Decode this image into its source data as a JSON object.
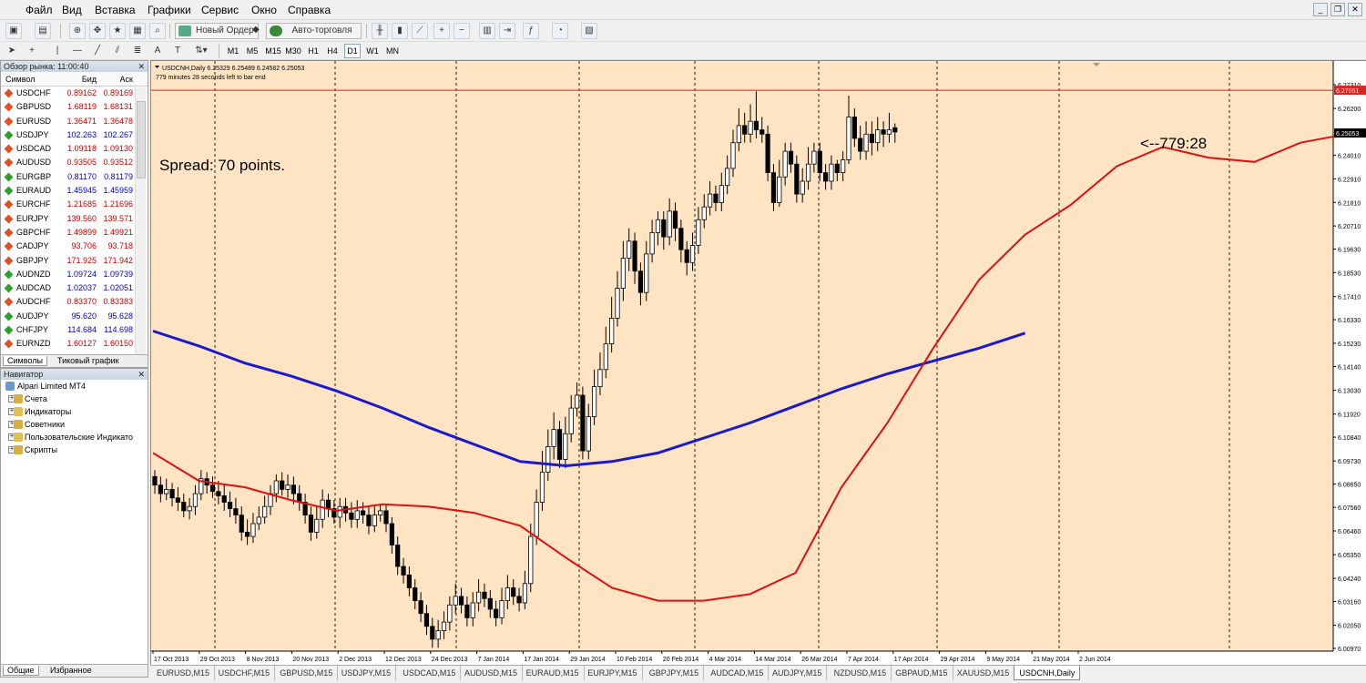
{
  "menu": [
    "Файл",
    "Вид",
    "Вставка",
    "Графики",
    "Сервис",
    "Окно",
    "Справка"
  ],
  "toolbar": {
    "new_order": "Новый Ордер",
    "autotrade": "Авто-торговля"
  },
  "timeframes": [
    "M1",
    "M5",
    "M15",
    "M30",
    "H1",
    "H4",
    "D1",
    "W1",
    "MN"
  ],
  "active_timeframe": "D1",
  "market_watch": {
    "title": "Обзор рынка: 11:00:40",
    "headers": {
      "symbol": "Символ",
      "bid": "Бид",
      "ask": "Аск"
    },
    "rows": [
      {
        "symbol": "USDCHF",
        "bid": "0.89162",
        "ask": "0.89169",
        "dir": "dn"
      },
      {
        "symbol": "GBPUSD",
        "bid": "1.68119",
        "ask": "1.68131",
        "dir": "dn"
      },
      {
        "symbol": "EURUSD",
        "bid": "1.36471",
        "ask": "1.36478",
        "dir": "dn"
      },
      {
        "symbol": "USDJPY",
        "bid": "102.263",
        "ask": "102.267",
        "dir": "up"
      },
      {
        "symbol": "USDCAD",
        "bid": "1.09118",
        "ask": "1.09130",
        "dir": "dn"
      },
      {
        "symbol": "AUDUSD",
        "bid": "0.93505",
        "ask": "0.93512",
        "dir": "dn"
      },
      {
        "symbol": "EURGBP",
        "bid": "0.81170",
        "ask": "0.81179",
        "dir": "up"
      },
      {
        "symbol": "EURAUD",
        "bid": "1.45945",
        "ask": "1.45959",
        "dir": "up"
      },
      {
        "symbol": "EURCHF",
        "bid": "1.21685",
        "ask": "1.21696",
        "dir": "dn"
      },
      {
        "symbol": "EURJPY",
        "bid": "139.560",
        "ask": "139.571",
        "dir": "dn"
      },
      {
        "symbol": "GBPCHF",
        "bid": "1.49899",
        "ask": "1.49921",
        "dir": "dn"
      },
      {
        "symbol": "CADJPY",
        "bid": "93.706",
        "ask": "93.718",
        "dir": "dn"
      },
      {
        "symbol": "GBPJPY",
        "bid": "171.925",
        "ask": "171.942",
        "dir": "dn"
      },
      {
        "symbol": "AUDNZD",
        "bid": "1.09724",
        "ask": "1.09739",
        "dir": "up"
      },
      {
        "symbol": "AUDCAD",
        "bid": "1.02037",
        "ask": "1.02051",
        "dir": "up"
      },
      {
        "symbol": "AUDCHF",
        "bid": "0.83370",
        "ask": "0.83383",
        "dir": "dn"
      },
      {
        "symbol": "AUDJPY",
        "bid": "95.620",
        "ask": "95.628",
        "dir": "up"
      },
      {
        "symbol": "CHFJPY",
        "bid": "114.684",
        "ask": "114.698",
        "dir": "up"
      },
      {
        "symbol": "EURNZD",
        "bid": "1.60127",
        "ask": "1.60150",
        "dir": "dn"
      }
    ],
    "tabs": [
      "Символы",
      "Тиковый график"
    ]
  },
  "navigator": {
    "title": "Навигатор",
    "root": "Alpari Limited MT4",
    "items": [
      "Счета",
      "Индикаторы",
      "Советники",
      "Пользовательские Индикато",
      "Скрипты"
    ],
    "tabs": [
      "Общие",
      "Избранное"
    ]
  },
  "chart_tabs": [
    "EURUSD,M15",
    "USDCHF,M15",
    "GBPUSD,M15",
    "USDJPY,M15",
    "USDCAD,M15",
    "AUDUSD,M15",
    "EURAUD,M15",
    "EURJPY,M15",
    "GBPJPY,M15",
    "AUDCAD,M15",
    "AUDJPY,M15",
    "NZDUSD,M15",
    "GBPAUD,M15",
    "XAUUSD,M15",
    "USDCNH,Daily"
  ],
  "active_chart_tab": "USDCNH,Daily",
  "chart_data": {
    "type": "candlestick",
    "symbol_line": "USDCNH,Daily  6.25329 6.25489 6.24582 6.25053",
    "timer_line": "779 minutes 28 seconds left to bar end",
    "spread_text": "Spread: 70 points.",
    "countdown_text": "<--779:28",
    "ylim": [
      6.0097,
      6.2731
    ],
    "y_ticks": [
      "6.27310",
      "6.26200",
      "6.25053",
      "6.24010",
      "6.22910",
      "6.21810",
      "6.20710",
      "6.19630",
      "6.18530",
      "6.17410",
      "6.16330",
      "6.15230",
      "6.14140",
      "6.13030",
      "6.11920",
      "6.10840",
      "6.09730",
      "6.08650",
      "6.07560",
      "6.06460",
      "6.05350",
      "6.04240",
      "6.03160",
      "6.02050",
      "6.00970"
    ],
    "y_tick_values": [
      6.2731,
      6.262,
      6.25053,
      6.2401,
      6.2291,
      6.2181,
      6.2071,
      6.1963,
      6.1853,
      6.1741,
      6.1633,
      6.1523,
      6.1414,
      6.1303,
      6.1192,
      6.1084,
      6.0973,
      6.0865,
      6.0756,
      6.0646,
      6.0535,
      6.0424,
      6.0316,
      6.0205,
      6.0097
    ],
    "price_line": 6.27051,
    "price_line_label": "6.27051",
    "current_price": 6.25053,
    "current_price_label": "6.25053",
    "x_labels": [
      "17 Oct 2013",
      "29 Oct 2013",
      "8 Nov 2013",
      "20 Nov 2013",
      "2 Dec 2013",
      "12 Dec 2013",
      "24 Dec 2013",
      "7 Jan 2014",
      "17 Jan 2014",
      "29 Jan 2014",
      "10 Feb 2014",
      "20 Feb 2014",
      "4 Mar 2014",
      "14 Mar 2014",
      "26 Mar 2014",
      "7 Apr 2014",
      "17 Apr 2014",
      "29 Apr 2014",
      "9 May 2014",
      "21 May 2014",
      "2 Jun 2014"
    ],
    "x_label_index": [
      0,
      8,
      16,
      24,
      32,
      40,
      48,
      56,
      64,
      72,
      80,
      88,
      96,
      104,
      112,
      120,
      128,
      136,
      144,
      152,
      160
    ],
    "bars_total": 164,
    "ma_slow_color": "#1a1acc",
    "ma_fast_color": "#dd1111",
    "ma_slow": [
      [
        0,
        6.158
      ],
      [
        20,
        6.151
      ],
      [
        40,
        6.143
      ],
      [
        60,
        6.137
      ],
      [
        80,
        6.13
      ],
      [
        100,
        6.122
      ],
      [
        120,
        6.113
      ],
      [
        140,
        6.105
      ],
      [
        160,
        6.097
      ],
      [
        180,
        6.095
      ],
      [
        200,
        6.097
      ],
      [
        220,
        6.101
      ],
      [
        240,
        6.108
      ],
      [
        260,
        6.115
      ],
      [
        280,
        6.123
      ],
      [
        300,
        6.131
      ],
      [
        320,
        6.138
      ],
      [
        340,
        6.144
      ],
      [
        360,
        6.15
      ],
      [
        380,
        6.157
      ]
    ],
    "ma_fast": [
      [
        0,
        6.101
      ],
      [
        20,
        6.088
      ],
      [
        40,
        6.085
      ],
      [
        60,
        6.079
      ],
      [
        80,
        6.074
      ],
      [
        100,
        6.077
      ],
      [
        120,
        6.076
      ],
      [
        140,
        6.073
      ],
      [
        160,
        6.067
      ],
      [
        180,
        6.052
      ],
      [
        200,
        6.038
      ],
      [
        220,
        6.032
      ],
      [
        240,
        6.032
      ],
      [
        260,
        6.035
      ],
      [
        280,
        6.045
      ],
      [
        300,
        6.085
      ],
      [
        320,
        6.115
      ],
      [
        340,
        6.15
      ],
      [
        360,
        6.182
      ],
      [
        380,
        6.203
      ],
      [
        400,
        6.217
      ],
      [
        420,
        6.235
      ],
      [
        440,
        6.244
      ],
      [
        460,
        6.239
      ],
      [
        480,
        6.237
      ],
      [
        500,
        6.246
      ],
      [
        520,
        6.25
      ]
    ],
    "candles": [
      [
        6.09,
        6.086,
        6.093,
        6.082
      ],
      [
        6.086,
        6.082,
        6.09,
        6.078
      ],
      [
        6.082,
        6.084,
        6.089,
        6.079
      ],
      [
        6.084,
        6.08,
        6.087,
        6.076
      ],
      [
        6.08,
        6.078,
        6.085,
        6.074
      ],
      [
        6.078,
        6.074,
        6.082,
        6.071
      ],
      [
        6.074,
        6.076,
        6.08,
        6.07
      ],
      [
        6.076,
        6.082,
        6.086,
        6.072
      ],
      [
        6.082,
        6.089,
        6.093,
        6.079
      ],
      [
        6.089,
        6.086,
        6.092,
        6.082
      ],
      [
        6.086,
        6.083,
        6.09,
        6.08
      ],
      [
        6.083,
        6.081,
        6.088,
        6.077
      ],
      [
        6.081,
        6.078,
        6.086,
        6.074
      ],
      [
        6.078,
        6.075,
        6.083,
        6.071
      ],
      [
        6.075,
        6.072,
        6.08,
        6.068
      ],
      [
        6.072,
        6.064,
        6.076,
        6.06
      ],
      [
        6.064,
        6.062,
        6.07,
        6.058
      ],
      [
        6.062,
        6.068,
        6.073,
        6.059
      ],
      [
        6.068,
        6.071,
        6.076,
        6.065
      ],
      [
        6.071,
        6.076,
        6.081,
        6.068
      ],
      [
        6.076,
        6.082,
        6.086,
        6.072
      ],
      [
        6.082,
        6.088,
        6.091,
        6.078
      ],
      [
        6.088,
        6.084,
        6.092,
        6.081
      ],
      [
        6.084,
        6.086,
        6.091,
        6.08
      ],
      [
        6.086,
        6.082,
        6.09,
        6.077
      ],
      [
        6.082,
        6.078,
        6.086,
        6.074
      ],
      [
        6.078,
        6.072,
        6.082,
        6.068
      ],
      [
        6.072,
        6.064,
        6.076,
        6.06
      ],
      [
        6.064,
        6.07,
        6.076,
        6.061
      ],
      [
        6.07,
        6.079,
        6.084,
        6.066
      ],
      [
        6.079,
        6.075,
        6.082,
        6.071
      ],
      [
        6.075,
        6.071,
        6.079,
        6.068
      ],
      [
        6.071,
        6.076,
        6.08,
        6.066
      ],
      [
        6.076,
        6.073,
        6.08,
        6.069
      ],
      [
        6.073,
        6.07,
        6.078,
        6.066
      ],
      [
        6.07,
        6.074,
        6.079,
        6.066
      ],
      [
        6.074,
        6.072,
        6.078,
        6.068
      ],
      [
        6.072,
        6.067,
        6.076,
        6.063
      ],
      [
        6.067,
        6.072,
        6.076,
        6.064
      ],
      [
        6.072,
        6.074,
        6.077,
        6.069
      ],
      [
        6.074,
        6.068,
        6.077,
        6.064
      ],
      [
        6.068,
        6.058,
        6.071,
        6.054
      ],
      [
        6.058,
        6.048,
        6.062,
        6.044
      ],
      [
        6.048,
        6.044,
        6.052,
        6.04
      ],
      [
        6.044,
        6.038,
        6.048,
        6.034
      ],
      [
        6.038,
        6.032,
        6.042,
        6.028
      ],
      [
        6.032,
        6.026,
        6.036,
        6.022
      ],
      [
        6.026,
        6.02,
        6.03,
        6.016
      ],
      [
        6.02,
        6.014,
        6.024,
        6.01
      ],
      [
        6.014,
        6.018,
        6.023,
        6.01
      ],
      [
        6.018,
        6.022,
        6.027,
        6.014
      ],
      [
        6.022,
        6.03,
        6.034,
        6.018
      ],
      [
        6.03,
        6.034,
        6.04,
        6.026
      ],
      [
        6.034,
        6.03,
        6.038,
        6.026
      ],
      [
        6.03,
        6.024,
        6.034,
        6.02
      ],
      [
        6.024,
        6.031,
        6.036,
        6.02
      ],
      [
        6.031,
        6.036,
        6.042,
        6.027
      ],
      [
        6.036,
        6.033,
        6.04,
        6.029
      ],
      [
        6.033,
        6.028,
        6.037,
        6.024
      ],
      [
        6.028,
        6.024,
        6.032,
        6.02
      ],
      [
        6.024,
        6.032,
        6.038,
        6.021
      ],
      [
        6.032,
        6.038,
        6.044,
        6.028
      ],
      [
        6.038,
        6.034,
        6.042,
        6.03
      ],
      [
        6.034,
        6.031,
        6.038,
        6.027
      ],
      [
        6.031,
        6.04,
        6.046,
        6.028
      ],
      [
        6.04,
        6.062,
        6.068,
        6.036
      ],
      [
        6.062,
        6.078,
        6.084,
        6.058
      ],
      [
        6.078,
        6.092,
        6.102,
        6.074
      ],
      [
        6.092,
        6.104,
        6.112,
        6.088
      ],
      [
        6.104,
        6.112,
        6.12,
        6.098
      ],
      [
        6.112,
        6.098,
        6.116,
        6.094
      ],
      [
        6.098,
        6.11,
        6.118,
        6.094
      ],
      [
        6.11,
        6.122,
        6.128,
        6.106
      ],
      [
        6.122,
        6.128,
        6.134,
        6.118
      ],
      [
        6.128,
        6.102,
        6.132,
        6.098
      ],
      [
        6.102,
        6.118,
        6.124,
        6.098
      ],
      [
        6.118,
        6.132,
        6.14,
        6.114
      ],
      [
        6.132,
        6.14,
        6.148,
        6.128
      ],
      [
        6.14,
        6.152,
        6.16,
        6.136
      ],
      [
        6.152,
        6.164,
        6.174,
        6.148
      ],
      [
        6.164,
        6.178,
        6.186,
        6.16
      ],
      [
        6.178,
        6.192,
        6.2,
        6.172
      ],
      [
        6.192,
        6.2,
        6.206,
        6.186
      ],
      [
        6.2,
        6.186,
        6.204,
        6.18
      ],
      [
        6.186,
        6.176,
        6.19,
        6.17
      ],
      [
        6.176,
        6.194,
        6.2,
        6.172
      ],
      [
        6.194,
        6.204,
        6.21,
        6.19
      ],
      [
        6.204,
        6.21,
        6.214,
        6.198
      ],
      [
        6.21,
        6.202,
        6.214,
        6.196
      ],
      [
        6.202,
        6.214,
        6.22,
        6.198
      ],
      [
        6.214,
        6.206,
        6.218,
        6.2
      ],
      [
        6.206,
        6.196,
        6.21,
        6.19
      ],
      [
        6.196,
        6.19,
        6.2,
        6.184
      ],
      [
        6.19,
        6.198,
        6.204,
        6.186
      ],
      [
        6.198,
        6.21,
        6.216,
        6.194
      ],
      [
        6.21,
        6.216,
        6.222,
        6.206
      ],
      [
        6.216,
        6.222,
        6.228,
        6.212
      ],
      [
        6.222,
        6.218,
        6.226,
        6.214
      ],
      [
        6.218,
        6.226,
        6.232,
        6.214
      ],
      [
        6.226,
        6.234,
        6.24,
        6.222
      ],
      [
        6.234,
        6.246,
        6.252,
        6.23
      ],
      [
        6.246,
        6.254,
        6.262,
        6.242
      ],
      [
        6.254,
        6.25,
        6.26,
        6.246
      ],
      [
        6.25,
        6.256,
        6.264,
        6.246
      ],
      [
        6.256,
        6.252,
        6.27,
        6.248
      ],
      [
        6.252,
        6.25,
        6.258,
        6.246
      ],
      [
        6.25,
        6.232,
        6.254,
        6.228
      ],
      [
        6.232,
        6.218,
        6.236,
        6.214
      ],
      [
        6.218,
        6.23,
        6.238,
        6.216
      ],
      [
        6.23,
        6.242,
        6.246,
        6.226
      ],
      [
        6.242,
        6.236,
        6.246,
        6.232
      ],
      [
        6.236,
        6.222,
        6.24,
        6.218
      ],
      [
        6.222,
        6.228,
        6.234,
        6.218
      ],
      [
        6.228,
        6.236,
        6.244,
        6.224
      ],
      [
        6.236,
        6.242,
        6.246,
        6.232
      ],
      [
        6.242,
        6.232,
        6.246,
        6.228
      ],
      [
        6.232,
        6.228,
        6.236,
        6.224
      ],
      [
        6.228,
        6.236,
        6.24,
        6.224
      ],
      [
        6.236,
        6.232,
        6.238,
        6.228
      ],
      [
        6.232,
        6.238,
        6.242,
        6.228
      ],
      [
        6.238,
        6.258,
        6.268,
        6.236
      ],
      [
        6.258,
        6.248,
        6.262,
        6.244
      ],
      [
        6.248,
        6.242,
        6.254,
        6.238
      ],
      [
        6.242,
        6.25,
        6.256,
        6.238
      ],
      [
        6.25,
        6.246,
        6.256,
        6.24
      ],
      [
        6.246,
        6.252,
        6.258,
        6.242
      ],
      [
        6.252,
        6.25,
        6.256,
        6.244
      ],
      [
        6.25,
        6.252,
        6.26,
        6.246
      ],
      [
        6.253,
        6.251,
        6.255,
        6.246
      ]
    ]
  }
}
